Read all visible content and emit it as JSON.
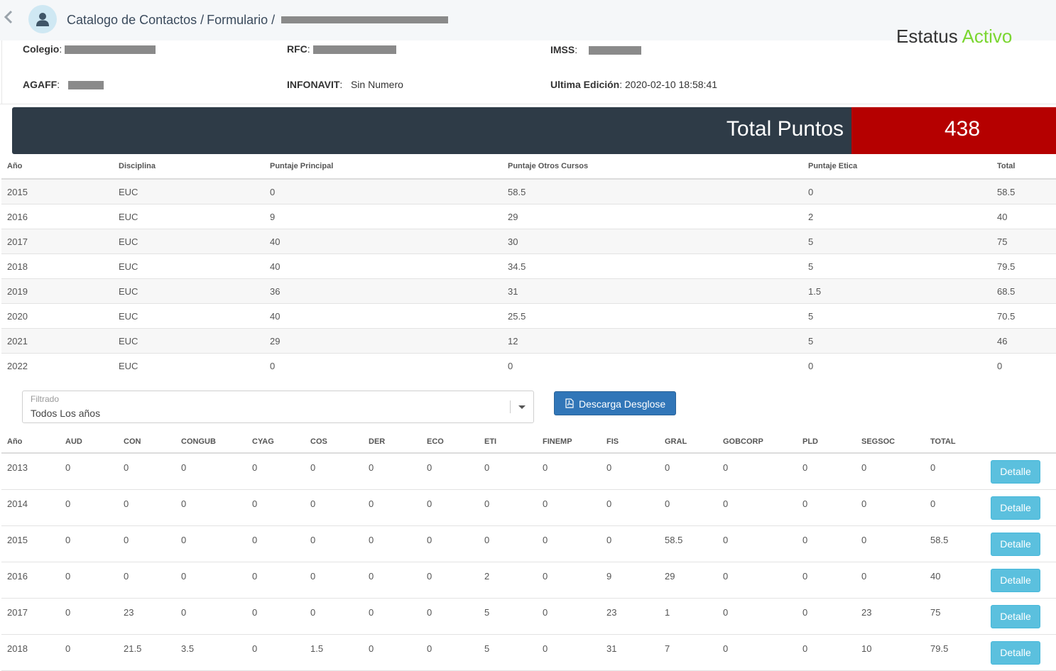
{
  "header": {
    "crumbs": [
      "Catalogo de Contactos /",
      "Formulario /"
    ]
  },
  "info": {
    "colegio_label": "Colegio",
    "rfc_label": "RFC",
    "imss_label": "IMSS",
    "agaff_label": "AGAFF",
    "infonavit_label": "INFONAVIT",
    "infonavit_value": "Sin Numero",
    "ultima_label": "Ultima Edición",
    "ultima_value": "2020-02-10 18:58:41",
    "estatus_label": "Estatus",
    "estatus_value": "Activo"
  },
  "total": {
    "label": "Total Puntos",
    "value": "438"
  },
  "table1": {
    "headers": [
      "Año",
      "Disciplina",
      "Puntaje Principal",
      "Puntaje Otros Cursos",
      "Puntaje Etica",
      "Total"
    ],
    "rows": [
      [
        "2015",
        "EUC",
        "0",
        "58.5",
        "0",
        "58.5"
      ],
      [
        "2016",
        "EUC",
        "9",
        "29",
        "2",
        "40"
      ],
      [
        "2017",
        "EUC",
        "40",
        "30",
        "5",
        "75"
      ],
      [
        "2018",
        "EUC",
        "40",
        "34.5",
        "5",
        "79.5"
      ],
      [
        "2019",
        "EUC",
        "36",
        "31",
        "1.5",
        "68.5"
      ],
      [
        "2020",
        "EUC",
        "40",
        "25.5",
        "5",
        "70.5"
      ],
      [
        "2021",
        "EUC",
        "29",
        "12",
        "5",
        "46"
      ],
      [
        "2022",
        "EUC",
        "0",
        "0",
        "0",
        "0"
      ]
    ]
  },
  "filter": {
    "label": "Filtrado",
    "value": "Todos Los años"
  },
  "download_label": "Descarga Desglose",
  "table2": {
    "headers": [
      "Año",
      "AUD",
      "CON",
      "CONGUB",
      "CYAG",
      "COS",
      "DER",
      "ECO",
      "ETI",
      "FINEMP",
      "FIS",
      "GRAL",
      "GOBCORP",
      "PLD",
      "SEGSOC",
      "TOTAL"
    ],
    "detail_label": "Detalle",
    "rows": [
      [
        "2013",
        "0",
        "0",
        "0",
        "0",
        "0",
        "0",
        "0",
        "0",
        "0",
        "0",
        "0",
        "0",
        "0",
        "0",
        "0"
      ],
      [
        "2014",
        "0",
        "0",
        "0",
        "0",
        "0",
        "0",
        "0",
        "0",
        "0",
        "0",
        "0",
        "0",
        "0",
        "0",
        "0"
      ],
      [
        "2015",
        "0",
        "0",
        "0",
        "0",
        "0",
        "0",
        "0",
        "0",
        "0",
        "0",
        "58.5",
        "0",
        "0",
        "0",
        "58.5"
      ],
      [
        "2016",
        "0",
        "0",
        "0",
        "0",
        "0",
        "0",
        "0",
        "2",
        "0",
        "9",
        "29",
        "0",
        "0",
        "0",
        "40"
      ],
      [
        "2017",
        "0",
        "23",
        "0",
        "0",
        "0",
        "0",
        "0",
        "5",
        "0",
        "23",
        "1",
        "0",
        "0",
        "23",
        "75"
      ],
      [
        "2018",
        "0",
        "21.5",
        "3.5",
        "0",
        "1.5",
        "0",
        "0",
        "5",
        "0",
        "31",
        "7",
        "0",
        "0",
        "10",
        "79.5"
      ]
    ]
  }
}
